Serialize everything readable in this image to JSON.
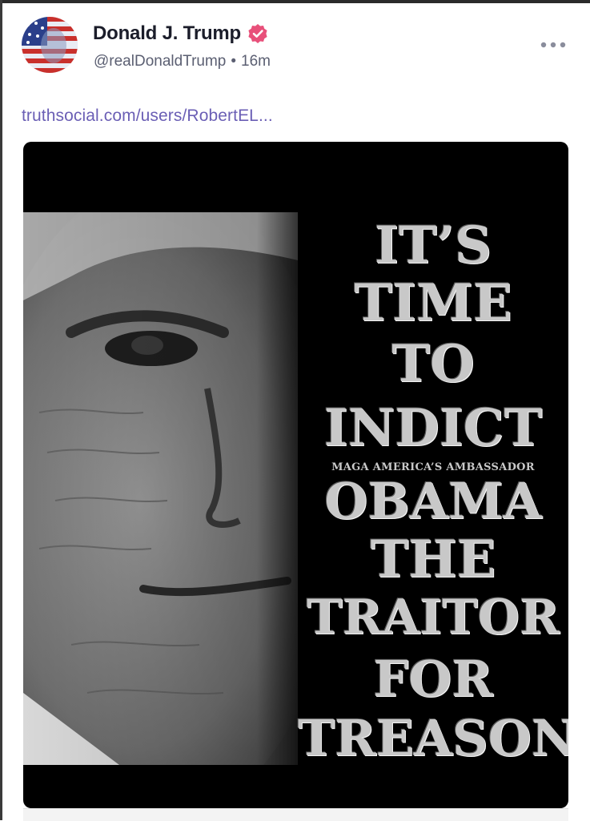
{
  "post": {
    "author": {
      "display_name": "Donald J. Trump",
      "handle": "@realDonaldTrump",
      "verified": true,
      "verified_color": "#e8507a"
    },
    "separator": "•",
    "time_ago": "16m",
    "more_icon": "more-horizontal-icon",
    "link_text": "truthsocial.com/users/RobertEL...",
    "link_color": "#6b5fb5",
    "image": {
      "headline_lines": [
        "IT’S",
        "TIME",
        "TO",
        "INDICT",
        "OBAMA",
        "THE",
        "TRAITOR",
        "FOR",
        "TREASON"
      ],
      "byline": "MAGA AMERICA’S AMBASSADOR"
    }
  }
}
